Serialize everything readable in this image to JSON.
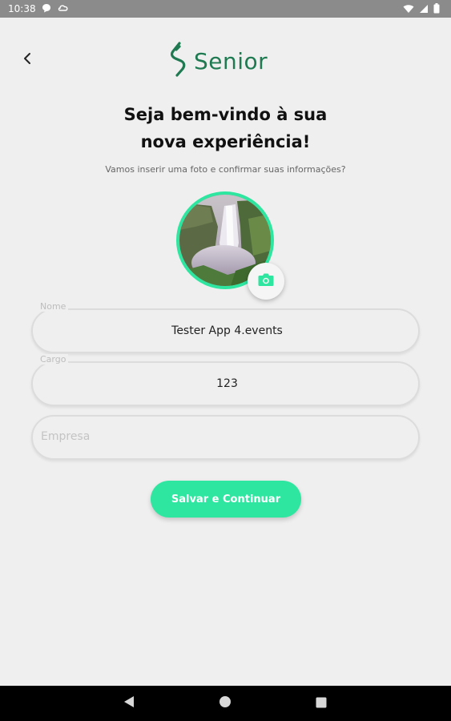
{
  "status_bar": {
    "time": "10:38",
    "left_icons": [
      "chat-bubble-icon",
      "cloud-sync-icon"
    ],
    "right_icons": [
      "wifi-icon",
      "signal-icon",
      "battery-icon"
    ]
  },
  "header": {
    "back_icon": "chevron-left-icon",
    "logo_text": "Senior",
    "brand_color": "#1f7a52"
  },
  "welcome": {
    "title_line1": "Seja bem-vindo à sua",
    "title_line2": "nova experiência!",
    "subtitle": "Vamos inserir uma foto e confirmar suas informações?"
  },
  "avatar": {
    "ring_color": "#2ee6a0",
    "camera_icon": "camera-icon"
  },
  "form": {
    "name": {
      "label": "Nome",
      "value": "Tester App 4.events"
    },
    "role": {
      "label": "Cargo",
      "value": "123"
    },
    "company": {
      "placeholder": "Empresa",
      "value": ""
    }
  },
  "actions": {
    "save_label": "Salvar e Continuar",
    "accent": "#2ee6a0"
  },
  "nav_bar": {
    "buttons": [
      "back-triangle-icon",
      "home-circle-icon",
      "recents-square-icon"
    ]
  }
}
